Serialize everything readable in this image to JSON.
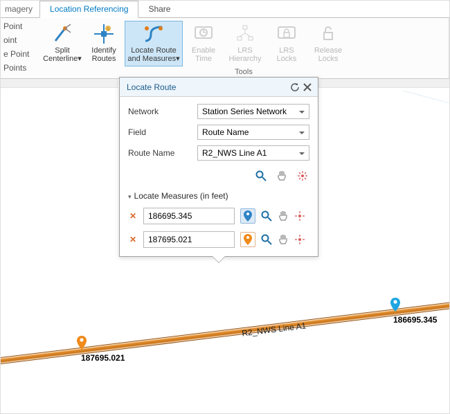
{
  "tabs": {
    "items": [
      "magery",
      "Location Referencing",
      "Share"
    ],
    "active_index": 1
  },
  "left_points": [
    "Point",
    "oint",
    "e Point",
    "Points"
  ],
  "ribbon": {
    "group_label": "Tools",
    "buttons": [
      {
        "line1": "Split",
        "line2": "Centerline▾",
        "caret": true
      },
      {
        "line1": "Identify",
        "line2": "Routes"
      },
      {
        "line1": "Locate Route",
        "line2": "and Measures▾",
        "caret": true
      },
      {
        "line1": "Enable",
        "line2": "Time",
        "disabled": true
      },
      {
        "line1": "LRS",
        "line2": "Hierarchy",
        "disabled": true
      },
      {
        "line1": "LRS",
        "line2": "Locks",
        "disabled": true
      },
      {
        "line1": "Release",
        "line2": "Locks",
        "disabled": true
      }
    ]
  },
  "panel": {
    "title": "Locate Route",
    "form": {
      "network_label": "Network",
      "network_value": "Station Series Network",
      "field_label": "Field",
      "field_value": "Route Name",
      "route_label": "Route Name",
      "route_value": "R2_NWS Line A1"
    },
    "section_title": "Locate Measures (in feet)",
    "measures": [
      "186695.345",
      "187695.021"
    ]
  },
  "map": {
    "route_label": "R2_NWS Line A1",
    "markers": [
      {
        "color": "blue",
        "label": "186695.345"
      },
      {
        "color": "orange",
        "label": "187695.021"
      }
    ]
  }
}
